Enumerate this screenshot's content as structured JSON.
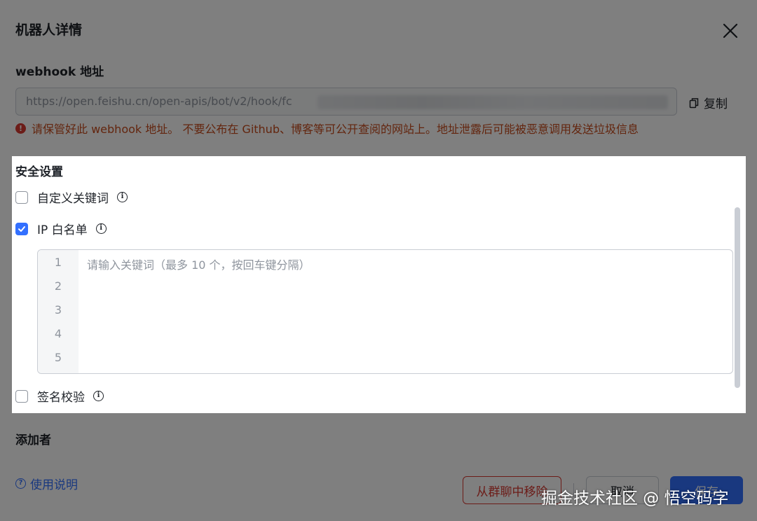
{
  "dialog": {
    "title": "机器人详情"
  },
  "webhook": {
    "label": "webhook 地址",
    "url_visible": "https://open.feishu.cn/open-apis/bot/v2/hook/fc",
    "copy_label": "复制",
    "warning_text": "请保管好此 webhook 地址。 不要公布在 Github、博客等可公开查阅的网站上。地址泄露后可能被恶意调用发送垃圾信息"
  },
  "security": {
    "title": "安全设置",
    "options": [
      {
        "label": "自定义关键词",
        "checked": false
      },
      {
        "label": "IP 白名单",
        "checked": true
      },
      {
        "label": "签名校验",
        "checked": false
      }
    ],
    "editor": {
      "placeholder": "请输入关键词（最多 10 个，按回车键分隔）",
      "line_numbers": [
        "1",
        "2",
        "3",
        "4",
        "5"
      ]
    }
  },
  "adder": {
    "title": "添加者"
  },
  "footer": {
    "help_label": "使用说明",
    "remove_label": "从群聊中移除",
    "cancel_label": "取消",
    "save_label": "保存"
  },
  "watermark": "掘金技术社区 @ 悟空码字",
  "colors": {
    "accent": "#3370ff",
    "danger": "#d83931",
    "warning_text": "#c64b1c"
  }
}
